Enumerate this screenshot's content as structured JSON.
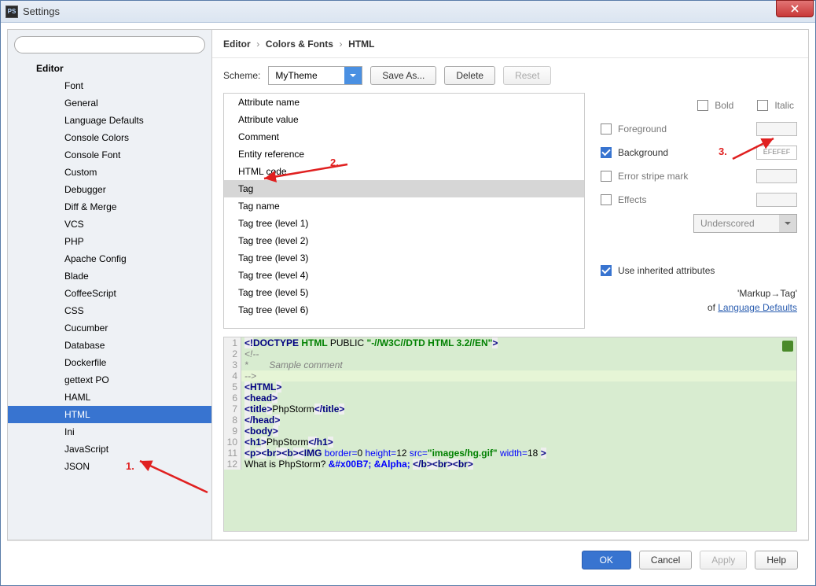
{
  "window": {
    "title": "Settings",
    "app_icon_text": "PS"
  },
  "search": {
    "placeholder": ""
  },
  "sidebar": {
    "top": "Editor",
    "items": [
      "Font",
      "General",
      "Language Defaults",
      "Console Colors",
      "Console Font",
      "Custom",
      "Debugger",
      "Diff & Merge",
      "VCS",
      "PHP",
      "Apache Config",
      "Blade",
      "CoffeeScript",
      "CSS",
      "Cucumber",
      "Database",
      "Dockerfile",
      "gettext PO",
      "HAML",
      "HTML",
      "Ini",
      "JavaScript",
      "JSON"
    ],
    "selected_index": 19
  },
  "breadcrumb": {
    "a": "Editor",
    "b": "Colors & Fonts",
    "c": "HTML"
  },
  "scheme": {
    "label": "Scheme:",
    "value": "MyTheme",
    "save_as": "Save As...",
    "delete": "Delete",
    "reset": "Reset"
  },
  "attrlist": {
    "items": [
      "Attribute name",
      "Attribute value",
      "Comment",
      "Entity reference",
      "HTML code",
      "Tag",
      "Tag name",
      "Tag tree (level 1)",
      "Tag tree (level 2)",
      "Tag tree (level 3)",
      "Tag tree (level 4)",
      "Tag tree (level 5)",
      "Tag tree (level 6)"
    ],
    "selected_index": 5
  },
  "opts": {
    "bold": "Bold",
    "italic": "Italic",
    "foreground": "Foreground",
    "background": "Background",
    "background_value": "EFEFEF",
    "error_stripe": "Error stripe mark",
    "effects": "Effects",
    "effects_type": "Underscored",
    "use_inherited": "Use inherited attributes",
    "inherit_text_1": "'Markup→Tag'",
    "inherit_text_2": "of ",
    "inherit_link": "Language Defaults"
  },
  "preview": {
    "lines": [
      {
        "n": "1",
        "html": "<span class='tok-tag'>&lt;!</span><span class='tok-tagname'>DOCTYPE </span><span class='tok-kw'>HTML </span><span class='tok-txt'>PUBLIC </span><span class='tok-str'>\"-//W3C//DTD HTML 3.2//EN\"</span><span class='tok-tag'>&gt;</span>"
      },
      {
        "n": "2",
        "html": "<span class='tok-cmt'>&lt;!--</span>"
      },
      {
        "n": "3",
        "html": "<span class='tok-cmt'>*        Sample comment</span>"
      },
      {
        "n": "4",
        "html": "<span class='tok-cmt'>--&gt;</span>",
        "hl": true
      },
      {
        "n": "5",
        "html": "<span class='tok-tag'>&lt;</span><span class='tok-tagname'>HTML</span><span class='tok-tag'>&gt;</span>"
      },
      {
        "n": "6",
        "html": "<span class='tok-tag'>&lt;</span><span class='tok-tagname'>head</span><span class='tok-tag'>&gt;</span>"
      },
      {
        "n": "7",
        "html": "<span class='tok-tag'>&lt;</span><span class='tok-tagname'>title</span><span class='tok-tag'>&gt;</span><span class='tok-txt'>PhpStorm</span><span class='tok-tag'>&lt;/</span><span class='tok-tagname'>title</span><span class='tok-tag'>&gt;</span>"
      },
      {
        "n": "8",
        "html": "<span class='tok-tag'>&lt;/</span><span class='tok-tagname'>head</span><span class='tok-tag'>&gt;</span>"
      },
      {
        "n": "9",
        "html": "<span class='tok-tag'>&lt;</span><span class='tok-tagname'>body</span><span class='tok-tag'>&gt;</span>"
      },
      {
        "n": "10",
        "html": "<span class='tok-tag'>&lt;</span><span class='tok-tagname'>h1</span><span class='tok-tag'>&gt;</span><span class='tok-txt'>PhpStorm</span><span class='tok-tag'>&lt;/</span><span class='tok-tagname'>h1</span><span class='tok-tag'>&gt;</span>"
      },
      {
        "n": "11",
        "html": "<span class='tok-tag'>&lt;</span><span class='tok-tagname'>p</span><span class='tok-tag'>&gt;&lt;</span><span class='tok-tagname'>br</span><span class='tok-tag'>&gt;&lt;</span><span class='tok-tagname'>b</span><span class='tok-tag'>&gt;&lt;</span><span class='tok-tagname'>IMG</span><span class='tok-txt'> </span><span class='tok-attr'>border=</span><span class='tok-txt'>0 </span><span class='tok-attr'>height=</span><span class='tok-txt'>12 </span><span class='tok-attr'>src=</span><span class='tok-str'>\"images/hg.gif\"</span><span class='tok-txt'> </span><span class='tok-attr'>width=</span><span class='tok-txt'>18 </span><span class='tok-tag'>&gt;</span>"
      },
      {
        "n": "12",
        "html": "<span class='tok-txt'>What is PhpStorm? </span><span class='tok-ent'>&amp;#x00B7;</span><span class='tok-txt'> </span><span class='tok-ent'>&amp;Alpha;</span><span class='tok-txt'> </span><span class='tok-tag'>&lt;/</span><span class='tok-tagname'>b</span><span class='tok-tag'>&gt;&lt;</span><span class='tok-tagname'>br</span><span class='tok-tag'>&gt;&lt;</span><span class='tok-tagname'>br</span><span class='tok-tag'>&gt;</span>"
      }
    ]
  },
  "footer": {
    "ok": "OK",
    "cancel": "Cancel",
    "apply": "Apply",
    "help": "Help"
  },
  "annotations": {
    "a1": "1.",
    "a2": "2.",
    "a3": "3."
  }
}
